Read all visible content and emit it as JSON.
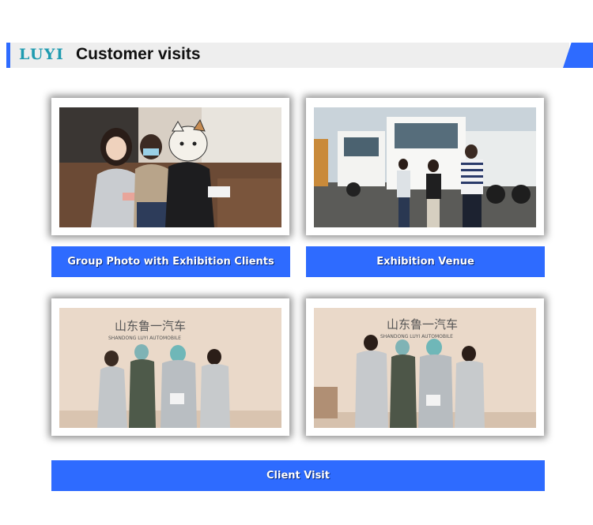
{
  "header": {
    "logo": "LUYI",
    "title": "Customer visits"
  },
  "captions": {
    "group_photo": "Group Photo with Exhibition Clients",
    "exhibition_venue": "Exhibition Venue",
    "client_visit": "Client Visit"
  },
  "wall_sign": {
    "chinese": "山东鲁一汽车",
    "english": "SHANDONG LUYI AUTOMOBILE"
  },
  "colors": {
    "accent": "#2e6bff",
    "logo": "#1f9bb0",
    "header_band": "#eeeeee"
  }
}
